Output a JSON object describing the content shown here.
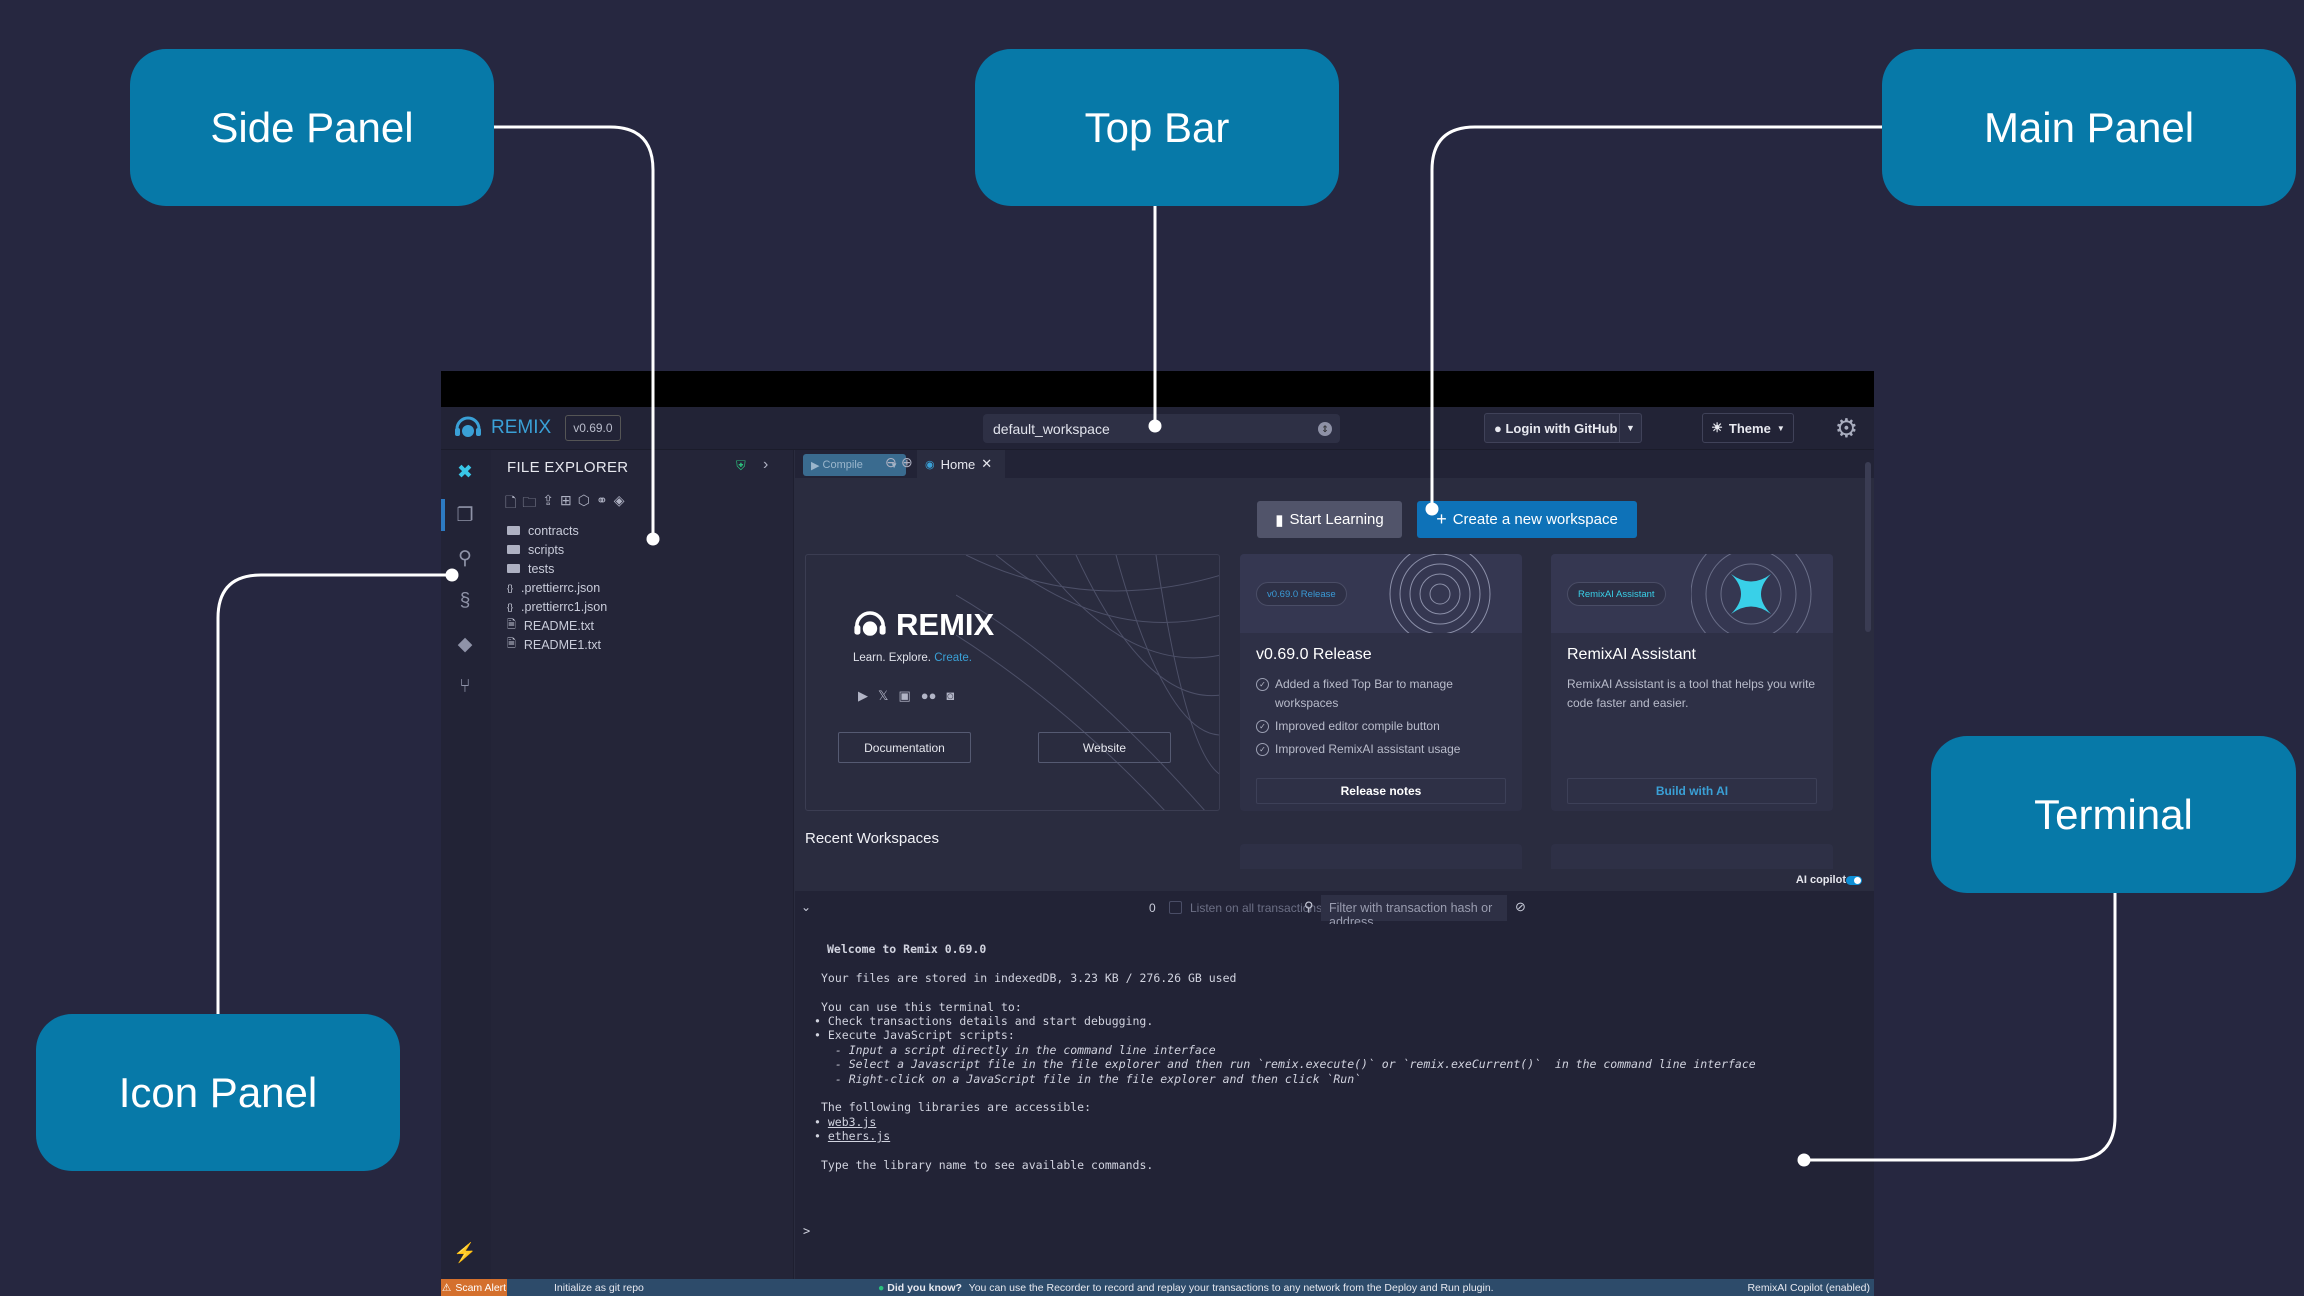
{
  "callouts": {
    "side_panel": "Side Panel",
    "top_bar": "Top Bar",
    "main_panel": "Main Panel",
    "icon_panel": "Icon Panel",
    "terminal": "Terminal"
  },
  "topbar": {
    "brand": "REMIX",
    "version": "v0.69.0",
    "workspace": "default_workspace",
    "login": "Login with GitHub",
    "theme": "Theme"
  },
  "icon_panel": {
    "items": [
      "remix-logo-icon",
      "file-explorer-icon",
      "search-icon",
      "solidity-compiler-icon",
      "deploy-run-icon",
      "git-icon"
    ],
    "bottom": "plugin-manager-icon"
  },
  "side_panel": {
    "title": "FILE EXPLORER",
    "files": [
      {
        "name": "contracts",
        "kind": "folder"
      },
      {
        "name": "scripts",
        "kind": "folder"
      },
      {
        "name": "tests",
        "kind": "folder"
      },
      {
        "name": ".prettierrc.json",
        "kind": "json"
      },
      {
        "name": ".prettierrc1.json",
        "kind": "json"
      },
      {
        "name": "README.txt",
        "kind": "file"
      },
      {
        "name": "README1.txt",
        "kind": "file"
      }
    ]
  },
  "main": {
    "compile": "Compile",
    "tab_home": "Home",
    "start_learning": "Start Learning",
    "create_workspace": "Create a new workspace",
    "hero": {
      "brand": "REMIX",
      "tagline": "Learn. Explore.",
      "tagline_accent": "Create.",
      "doc_btn": "Documentation",
      "web_btn": "Website"
    },
    "release_card": {
      "badge": "v0.69.0 Release",
      "title": "v0.69.0 Release",
      "items": [
        "Added a fixed Top Bar to manage workspaces",
        "Improved editor compile button",
        "Improved RemixAI assistant usage"
      ],
      "button": "Release notes"
    },
    "ai_card": {
      "badge": "RemixAI Assistant",
      "title": "RemixAI Assistant",
      "text": "RemixAI Assistant is a tool that helps you write code faster and easier.",
      "button": "Build with AI"
    },
    "recent_workspaces": "Recent Workspaces",
    "ai_copilot": "AI copilot"
  },
  "terminal_bar": {
    "count": "0",
    "listen": "Listen on all transactions",
    "filter_placeholder": "Filter with transaction hash or address"
  },
  "terminal": {
    "welcome": "Welcome to Remix 0.69.0",
    "storage": "Your files are stored in indexedDB, 3.23 KB / 276.26 GB used",
    "can_use": "You can use this terminal to:",
    "l1": "• Check transactions details and start debugging.",
    "l2": "• Execute JavaScript scripts:",
    "l3": "  - Input a script directly in the command line interface",
    "l4": "  - Select a Javascript file in the file explorer and then run `remix.execute()` or `remix.exeCurrent()`  in the command line interface",
    "l5": "  - Right-click on a JavaScript file in the file explorer and then click `Run`",
    "libs": "The following libraries are accessible:",
    "lib1": "web3.js",
    "lib2": "ethers.js",
    "type": "Type the library name to see available commands.",
    "prompt": ">"
  },
  "statusbar": {
    "scam": "Scam Alert",
    "git": "Initialize as git repo",
    "tip_label": "Did you know?",
    "tip": "You can use the Recorder to record and replay your transactions to any network from the Deploy and Run plugin.",
    "ai": "RemixAI Copilot (enabled)"
  },
  "colors": {
    "background": "#262740",
    "callout": "#0779a8",
    "accent": "#0e72b8",
    "scam": "#d4702d"
  }
}
